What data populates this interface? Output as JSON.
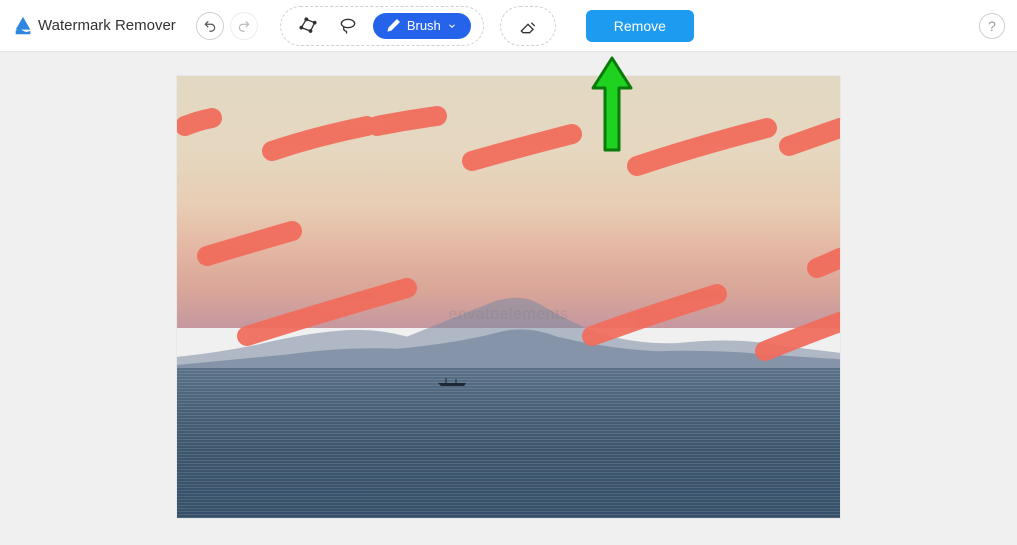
{
  "app": {
    "title": "Watermark Remover"
  },
  "toolbar": {
    "brush_label": "Brush",
    "remove_label": "Remove"
  },
  "image": {
    "watermark_text": "envatoelements"
  },
  "colors": {
    "brush_stroke": "#f26b5b",
    "arrow": "#1fd21f",
    "primary_button": "#1d9bf0",
    "brush_pill": "#2563eb"
  }
}
